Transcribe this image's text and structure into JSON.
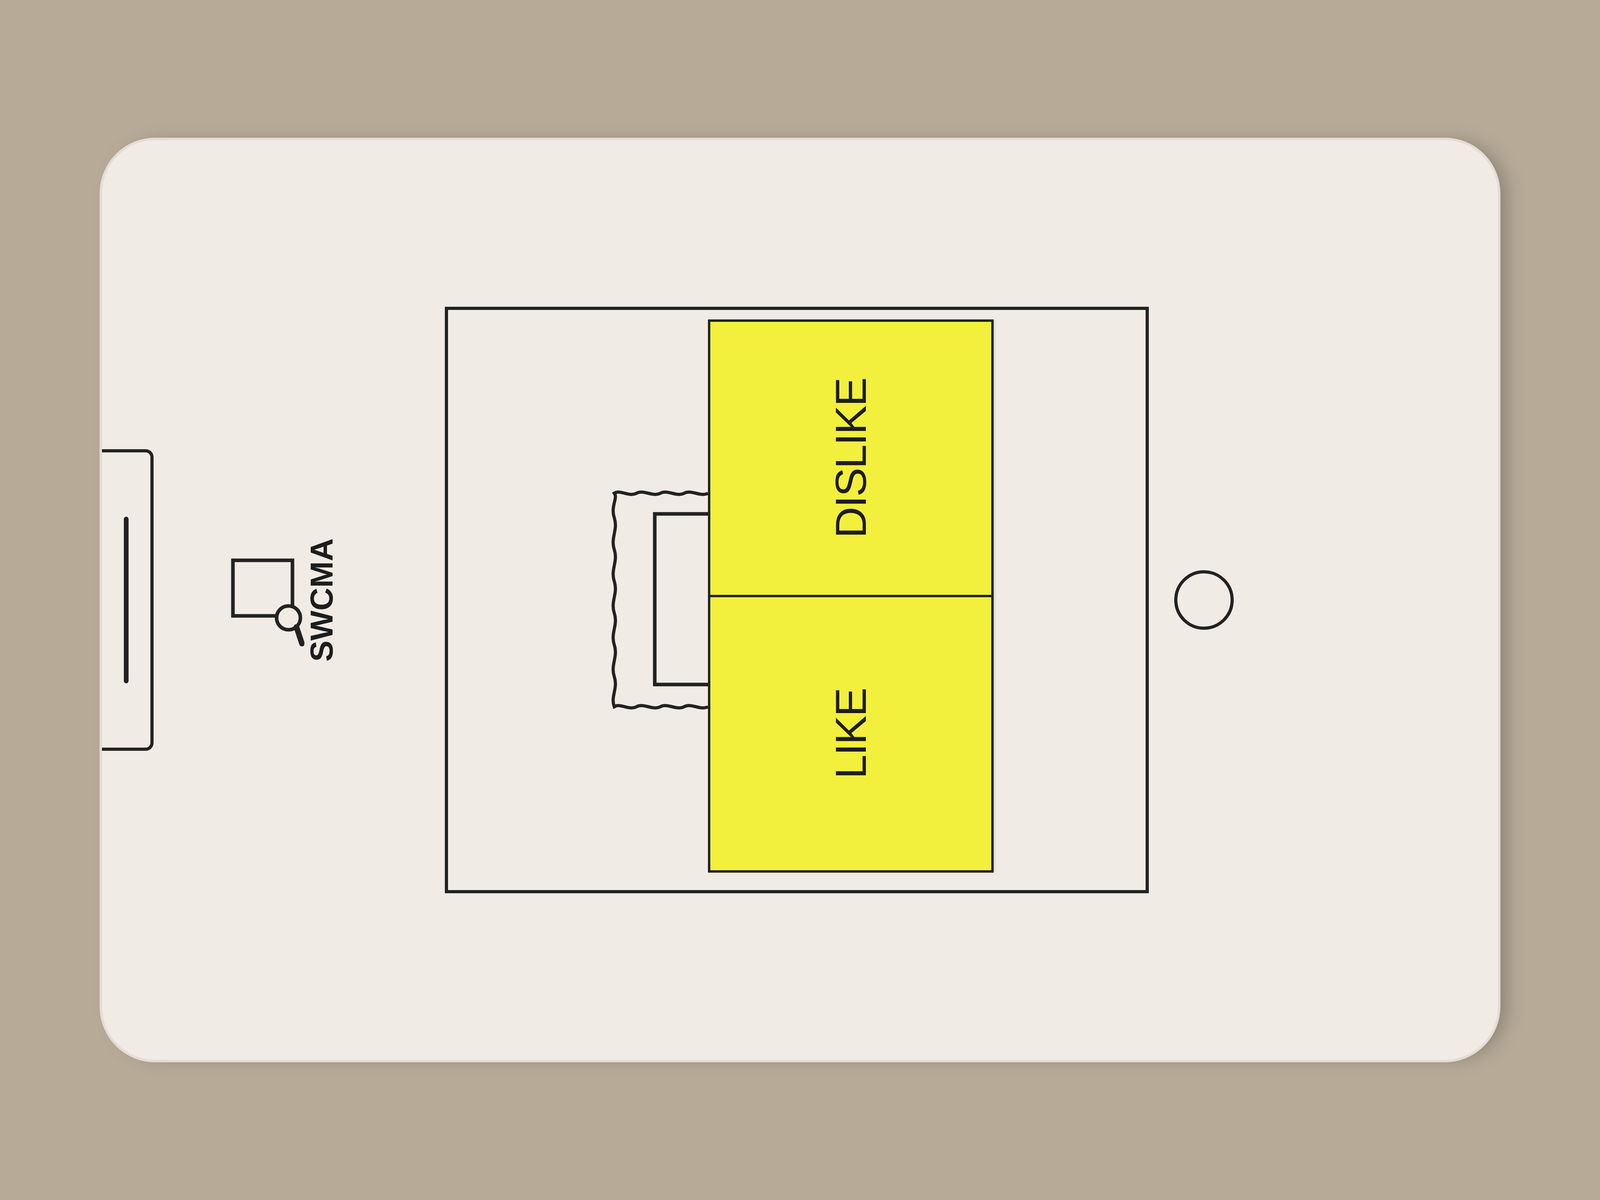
{
  "logo": {
    "text": "SWCMA"
  },
  "vote_buttons": [
    {
      "label": "LIKE"
    },
    {
      "label": "DISLIKE"
    }
  ]
}
